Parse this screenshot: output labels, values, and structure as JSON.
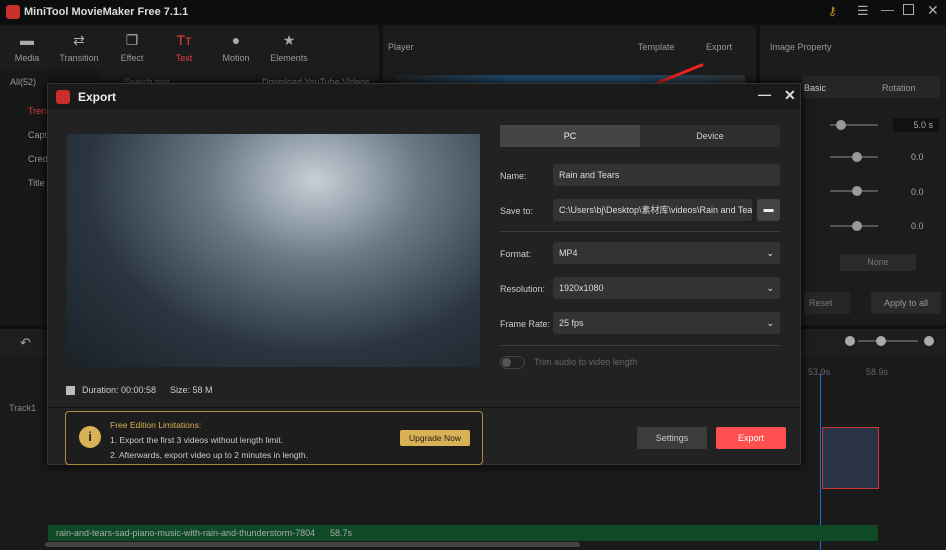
{
  "app": {
    "title": "MiniTool MovieMaker Free 7.1.1"
  },
  "toolbar": [
    {
      "label": "Media",
      "icon": "folder-icon"
    },
    {
      "label": "Transition",
      "icon": "swap-icon"
    },
    {
      "label": "Effect",
      "icon": "effect-icon"
    },
    {
      "label": "Text",
      "icon": "text-icon"
    },
    {
      "label": "Motion",
      "icon": "motion-icon"
    },
    {
      "label": "Elements",
      "icon": "star-icon"
    }
  ],
  "library": {
    "all": "All(52)",
    "search_placeholder": "Search text",
    "download": "Download YouTube Videos",
    "items": [
      "Trending",
      "Captions",
      "Credits",
      "Title"
    ]
  },
  "player": {
    "title": "Player",
    "template": "Template",
    "export": "Export"
  },
  "property": {
    "title": "Image Property",
    "tabs": [
      "Basic",
      "Rotation"
    ],
    "duration": "5.0 s",
    "values": [
      "0.0",
      "0.0",
      "0.0"
    ],
    "none": "None",
    "reset": "Reset",
    "apply": "Apply to all"
  },
  "timeline": {
    "marks": [
      "53.9s",
      "58.9s"
    ],
    "track": "Track1",
    "audio_name": "rain-and-tears-sad-piano-music-with-rain-and-thunderstorm-7804",
    "audio_dur": "58.7s"
  },
  "dialog": {
    "title": "Export",
    "tabs": [
      "PC",
      "Device"
    ],
    "name_label": "Name:",
    "name_value": "Rain and Tears",
    "save_label": "Save to:",
    "save_value": "C:\\Users\\bj\\Desktop\\素材库\\videos\\Rain and Tears",
    "format_label": "Format:",
    "format_value": "MP4",
    "resolution_label": "Resolution:",
    "resolution_value": "1920x1080",
    "framerate_label": "Frame Rate:",
    "framerate_value": "25 fps",
    "trim_label": "Trim audio to video length",
    "duration": "Duration:  00:00:58",
    "size": "Size:  58 M",
    "limit_title": "Free Edition Limitations:",
    "limit_1": "1. Export the first 3 videos without length limit.",
    "limit_2": "2. Afterwards, export video up to 2 minutes in length.",
    "upgrade": "Upgrade Now",
    "settings": "Settings",
    "export": "Export"
  },
  "colors": {
    "accent": "#ff4f4f",
    "gold": "#d9b255",
    "text_active": "#e0413c"
  }
}
